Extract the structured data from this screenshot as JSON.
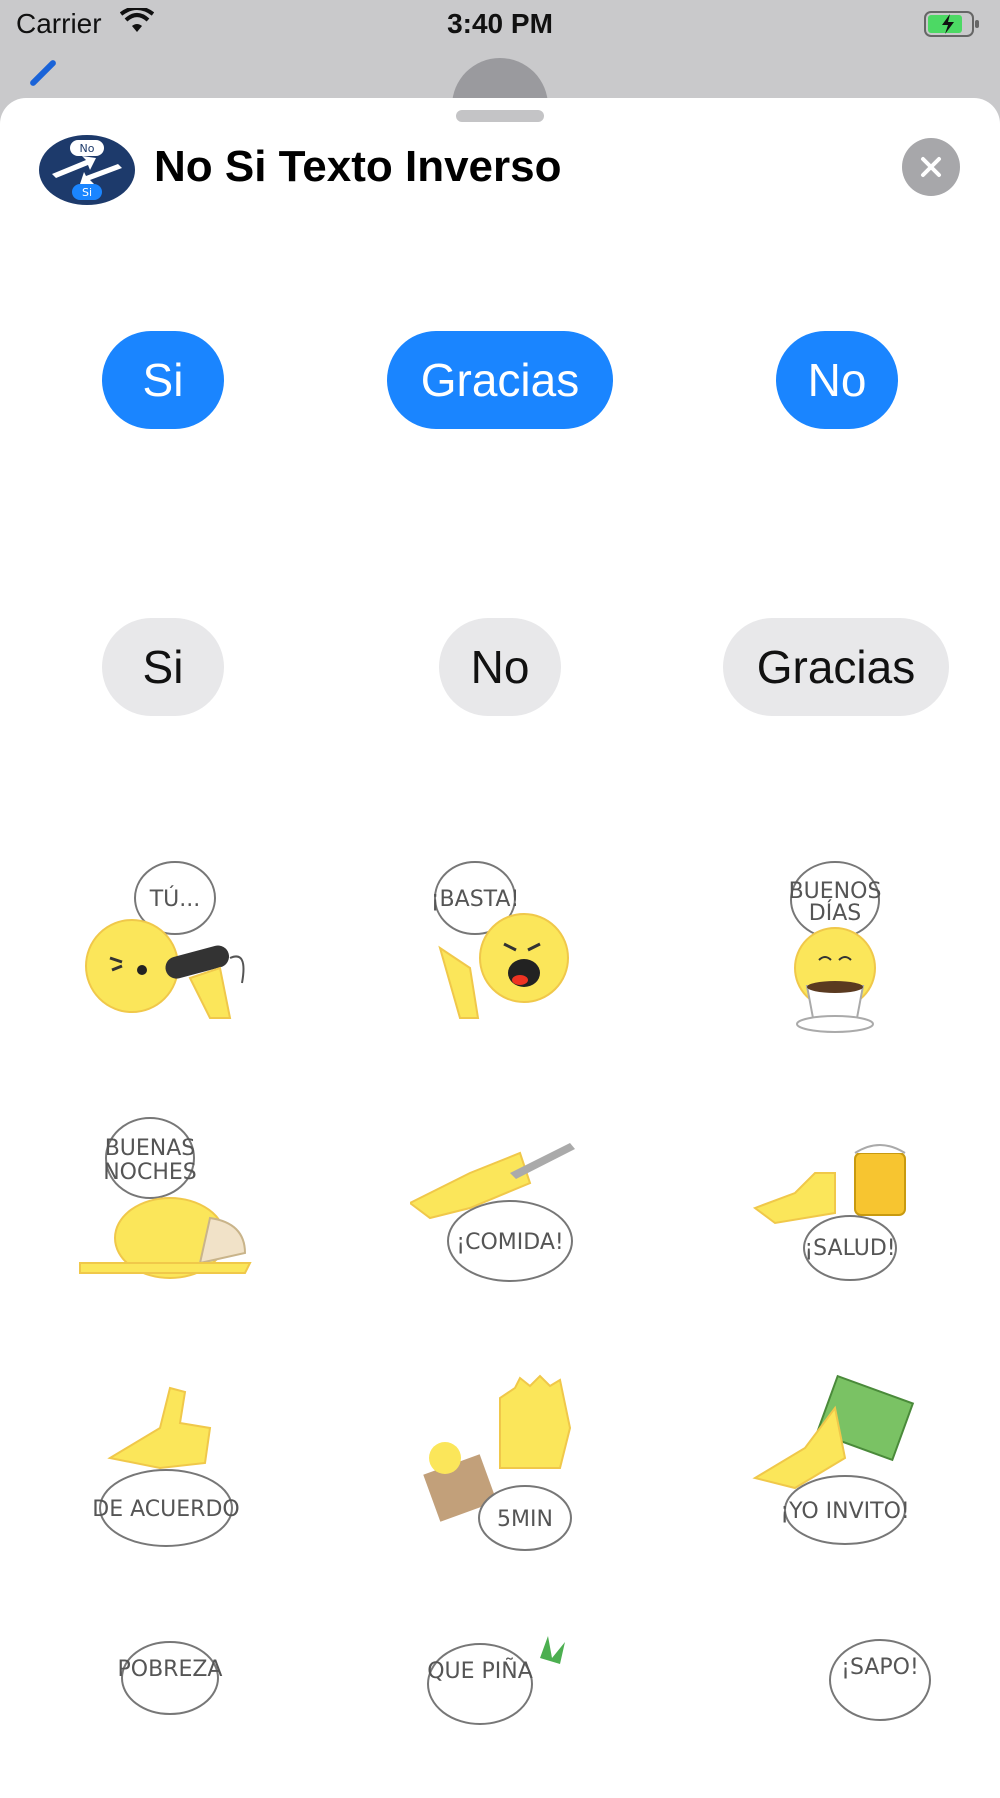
{
  "status_bar": {
    "carrier": "Carrier",
    "time": "3:40 PM"
  },
  "sheet": {
    "app_title": "No Si Texto Inverso",
    "app_icon_top": "No",
    "app_icon_bottom": "Si"
  },
  "blue_bubbles": [
    "Si",
    "Gracias",
    "No"
  ],
  "gray_bubbles": [
    "Si",
    "No",
    "Gracias"
  ],
  "stickers": {
    "tu": "TÚ...",
    "basta": "¡BASTA!",
    "buenos_1": "BUENOS",
    "buenos_2": "DÍAS",
    "buenas_1": "BUENAS",
    "buenas_2": "NOCHES",
    "comida": "¡COMIDA!",
    "salud": "¡SALUD!",
    "acuerdo": "DE ACUERDO",
    "cinco": "5MIN",
    "invito": "¡YO INVITO!",
    "pobreza": "POBREZA",
    "quepina": "QUE PIÑA",
    "sapo": "¡SAPO!"
  },
  "colors": {
    "accent": "#1a85ff",
    "gray_bubble": "#e8e8ea",
    "face": "#fbe65a"
  }
}
